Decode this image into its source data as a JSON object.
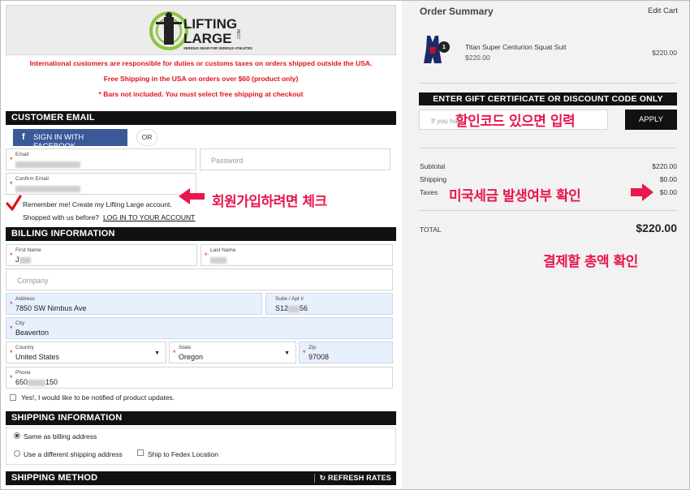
{
  "brand": {
    "logo_line1": "LIFTING",
    "logo_line2": "LARGE",
    "logo_com": ".COM",
    "tagline": "SERIOUS GEAR FOR SERIOUS ATHLETES"
  },
  "notices": [
    "International customers are responsible for duties or customs taxes on orders shipped outside the USA.",
    "Free Shipping in the USA on orders over $60 (product only)",
    "* Bars not included. You must select free shipping at checkout"
  ],
  "customer_email": {
    "section_title": "CUSTOMER EMAIL",
    "facebook_button": "SIGN IN WITH FACEBOOK",
    "facebook_icon": "f",
    "or_label": "OR",
    "email_label": "Email",
    "password_placeholder": "Password",
    "confirm_email_label": "Confirm Email",
    "remember_text": "Remember me! Create my Lifting Large account.",
    "shopped_before": "Shopped with us before?",
    "login_link": "LOG IN TO YOUR ACCOUNT"
  },
  "billing": {
    "section_title": "BILLING INFORMATION",
    "first_name_label": "First Name",
    "first_name_value": "J",
    "last_name_label": "Last Name",
    "company_placeholder": "Company",
    "address_label": "Address",
    "address_value": "7850 SW Nimbus Ave",
    "suite_label": "Suite / Apt #",
    "suite_prefix": "S12",
    "suite_suffix": "56",
    "city_label": "City",
    "city_value": "Beaverton",
    "country_label": "Country",
    "country_value": "United States",
    "state_label": "State",
    "state_value": "Oregon",
    "zip_label": "Zip",
    "zip_value": "97008",
    "phone_label": "Phone",
    "phone_prefix": "650",
    "phone_suffix": "150",
    "updates_text": "Yes!, I would like to be notified of product updates."
  },
  "shipping_info": {
    "section_title": "SHIPPING INFORMATION",
    "same_as_billing": "Same as billing address",
    "different_address": "Use a different shipping address",
    "fedex": "Ship to Fedex Location"
  },
  "shipping_method": {
    "section_title": "SHIPPING METHOD",
    "refresh_label": "REFRESH RATES"
  },
  "order_summary": {
    "title": "Order Summary",
    "edit_cart": "Edit Cart",
    "item": {
      "qty": "1",
      "name": "Titan Super Centurion Squat Suit",
      "unit_price": "$220.00",
      "line_total": "$220.00"
    },
    "gift_title": "ENTER GIFT CERTIFICATE OR DISCOUNT CODE ONLY",
    "gift_placeholder": "If you ha",
    "apply_button": "APPLY",
    "subtotal_label": "Subtotal",
    "subtotal_value": "$220.00",
    "shipping_label": "Shipping",
    "shipping_value": "$0.00",
    "taxes_label": "Taxes",
    "taxes_value": "$0.00",
    "total_label": "TOTAL",
    "total_value": "$220.00"
  },
  "annotations": {
    "signup_check": "회원가입하려면 체크",
    "discount_code": "할인코드 있으면 입력",
    "us_tax": "미국세금 발생여부 확인",
    "total_check": "결제할 총액 확인"
  },
  "colors": {
    "annotation": "#e8174c",
    "notice_red": "#e0121b",
    "facebook": "#3b5998",
    "logo_green": "#8cc63f",
    "field_blue": "#e8f0fe"
  }
}
